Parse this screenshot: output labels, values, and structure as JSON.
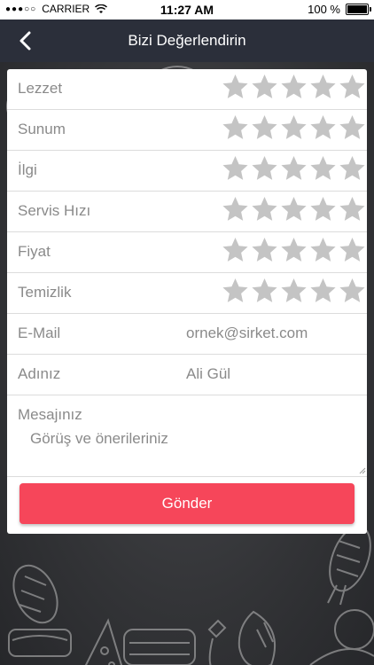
{
  "status_bar": {
    "carrier": "CARRIER",
    "time": "11:27 AM",
    "battery": "100 %"
  },
  "nav": {
    "title": "Bizi Değerlendirin"
  },
  "ratings": [
    {
      "label": "Lezzet",
      "stars": 0,
      "max": 5
    },
    {
      "label": "Sunum",
      "stars": 0,
      "max": 5
    },
    {
      "label": "İlgi",
      "stars": 0,
      "max": 5
    },
    {
      "label": "Servis Hızı",
      "stars": 0,
      "max": 5
    },
    {
      "label": "Fiyat",
      "stars": 0,
      "max": 5
    },
    {
      "label": "Temizlik",
      "stars": 0,
      "max": 5
    }
  ],
  "form": {
    "email_label": "E-Mail",
    "email_placeholder": "ornek@sirket.com",
    "name_label": "Adınız",
    "name_placeholder": "Ali Gül",
    "message_label": "Mesajınız",
    "message_placeholder": "Görüş ve önerileriniz",
    "submit_label": "Gönder"
  },
  "colors": {
    "nav_bg": "#2b2f3a",
    "star_empty": "#c4c4c4",
    "submit_bg": "#f6465a",
    "label_text": "#8a8a8a"
  }
}
